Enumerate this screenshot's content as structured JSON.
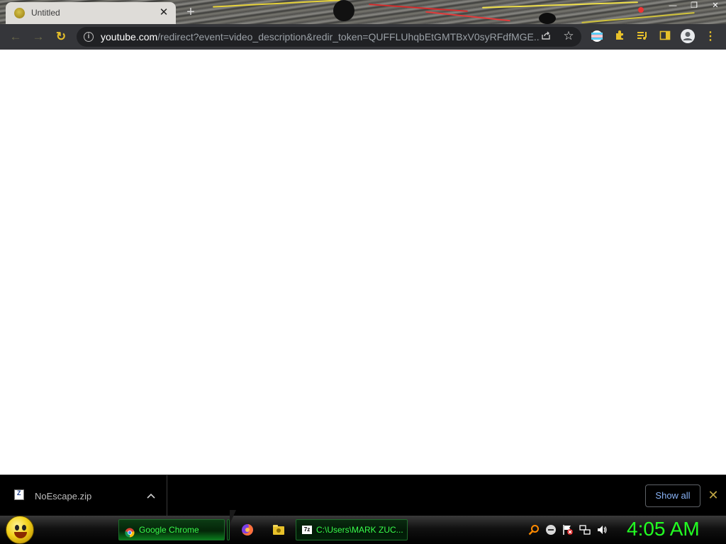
{
  "browser": {
    "tab": {
      "title": "Untitled",
      "close_glyph": "✕"
    },
    "new_tab_glyph": "+",
    "window_controls": {
      "minimize": "—",
      "maximize": "❐",
      "close": "✕"
    },
    "toolbar": {
      "back_glyph": "←",
      "forward_glyph": "→",
      "reload_glyph": "↻",
      "url_host": "youtube.com",
      "url_rest": "/redirect?event=video_description&redir_token=QUFFLUhqbEtGMTBxV0syRFdfMGE..."
    }
  },
  "downloads": {
    "file_name": "NoEscape.zip",
    "show_all_label": "Show all",
    "close_glyph": "✕"
  },
  "taskbar": {
    "buttons": [
      {
        "label": "Google Chrome"
      },
      {
        "label": "C:\\Users\\MARK ZUC..."
      }
    ],
    "clock": "4:05 AM"
  },
  "colors": {
    "accent_yellow": "#e8c12a",
    "taskbar_green": "#38ff4c",
    "clock_green": "#22ff22",
    "link_blue": "#8ab4f8"
  }
}
